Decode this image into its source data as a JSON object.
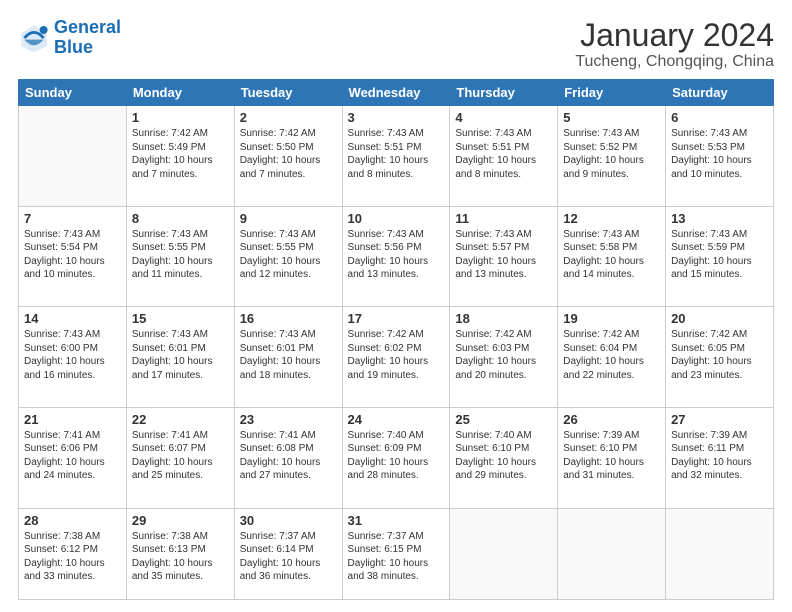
{
  "logo": {
    "line1": "General",
    "line2": "Blue"
  },
  "title": "January 2024",
  "subtitle": "Tucheng, Chongqing, China",
  "weekdays": [
    "Sunday",
    "Monday",
    "Tuesday",
    "Wednesday",
    "Thursday",
    "Friday",
    "Saturday"
  ],
  "weeks": [
    [
      {
        "day": "",
        "info": ""
      },
      {
        "day": "1",
        "info": "Sunrise: 7:42 AM\nSunset: 5:49 PM\nDaylight: 10 hours\nand 7 minutes."
      },
      {
        "day": "2",
        "info": "Sunrise: 7:42 AM\nSunset: 5:50 PM\nDaylight: 10 hours\nand 7 minutes."
      },
      {
        "day": "3",
        "info": "Sunrise: 7:43 AM\nSunset: 5:51 PM\nDaylight: 10 hours\nand 8 minutes."
      },
      {
        "day": "4",
        "info": "Sunrise: 7:43 AM\nSunset: 5:51 PM\nDaylight: 10 hours\nand 8 minutes."
      },
      {
        "day": "5",
        "info": "Sunrise: 7:43 AM\nSunset: 5:52 PM\nDaylight: 10 hours\nand 9 minutes."
      },
      {
        "day": "6",
        "info": "Sunrise: 7:43 AM\nSunset: 5:53 PM\nDaylight: 10 hours\nand 10 minutes."
      }
    ],
    [
      {
        "day": "7",
        "info": "Sunrise: 7:43 AM\nSunset: 5:54 PM\nDaylight: 10 hours\nand 10 minutes."
      },
      {
        "day": "8",
        "info": "Sunrise: 7:43 AM\nSunset: 5:55 PM\nDaylight: 10 hours\nand 11 minutes."
      },
      {
        "day": "9",
        "info": "Sunrise: 7:43 AM\nSunset: 5:55 PM\nDaylight: 10 hours\nand 12 minutes."
      },
      {
        "day": "10",
        "info": "Sunrise: 7:43 AM\nSunset: 5:56 PM\nDaylight: 10 hours\nand 13 minutes."
      },
      {
        "day": "11",
        "info": "Sunrise: 7:43 AM\nSunset: 5:57 PM\nDaylight: 10 hours\nand 13 minutes."
      },
      {
        "day": "12",
        "info": "Sunrise: 7:43 AM\nSunset: 5:58 PM\nDaylight: 10 hours\nand 14 minutes."
      },
      {
        "day": "13",
        "info": "Sunrise: 7:43 AM\nSunset: 5:59 PM\nDaylight: 10 hours\nand 15 minutes."
      }
    ],
    [
      {
        "day": "14",
        "info": "Sunrise: 7:43 AM\nSunset: 6:00 PM\nDaylight: 10 hours\nand 16 minutes."
      },
      {
        "day": "15",
        "info": "Sunrise: 7:43 AM\nSunset: 6:01 PM\nDaylight: 10 hours\nand 17 minutes."
      },
      {
        "day": "16",
        "info": "Sunrise: 7:43 AM\nSunset: 6:01 PM\nDaylight: 10 hours\nand 18 minutes."
      },
      {
        "day": "17",
        "info": "Sunrise: 7:42 AM\nSunset: 6:02 PM\nDaylight: 10 hours\nand 19 minutes."
      },
      {
        "day": "18",
        "info": "Sunrise: 7:42 AM\nSunset: 6:03 PM\nDaylight: 10 hours\nand 20 minutes."
      },
      {
        "day": "19",
        "info": "Sunrise: 7:42 AM\nSunset: 6:04 PM\nDaylight: 10 hours\nand 22 minutes."
      },
      {
        "day": "20",
        "info": "Sunrise: 7:42 AM\nSunset: 6:05 PM\nDaylight: 10 hours\nand 23 minutes."
      }
    ],
    [
      {
        "day": "21",
        "info": "Sunrise: 7:41 AM\nSunset: 6:06 PM\nDaylight: 10 hours\nand 24 minutes."
      },
      {
        "day": "22",
        "info": "Sunrise: 7:41 AM\nSunset: 6:07 PM\nDaylight: 10 hours\nand 25 minutes."
      },
      {
        "day": "23",
        "info": "Sunrise: 7:41 AM\nSunset: 6:08 PM\nDaylight: 10 hours\nand 27 minutes."
      },
      {
        "day": "24",
        "info": "Sunrise: 7:40 AM\nSunset: 6:09 PM\nDaylight: 10 hours\nand 28 minutes."
      },
      {
        "day": "25",
        "info": "Sunrise: 7:40 AM\nSunset: 6:10 PM\nDaylight: 10 hours\nand 29 minutes."
      },
      {
        "day": "26",
        "info": "Sunrise: 7:39 AM\nSunset: 6:10 PM\nDaylight: 10 hours\nand 31 minutes."
      },
      {
        "day": "27",
        "info": "Sunrise: 7:39 AM\nSunset: 6:11 PM\nDaylight: 10 hours\nand 32 minutes."
      }
    ],
    [
      {
        "day": "28",
        "info": "Sunrise: 7:38 AM\nSunset: 6:12 PM\nDaylight: 10 hours\nand 33 minutes."
      },
      {
        "day": "29",
        "info": "Sunrise: 7:38 AM\nSunset: 6:13 PM\nDaylight: 10 hours\nand 35 minutes."
      },
      {
        "day": "30",
        "info": "Sunrise: 7:37 AM\nSunset: 6:14 PM\nDaylight: 10 hours\nand 36 minutes."
      },
      {
        "day": "31",
        "info": "Sunrise: 7:37 AM\nSunset: 6:15 PM\nDaylight: 10 hours\nand 38 minutes."
      },
      {
        "day": "",
        "info": ""
      },
      {
        "day": "",
        "info": ""
      },
      {
        "day": "",
        "info": ""
      }
    ]
  ]
}
